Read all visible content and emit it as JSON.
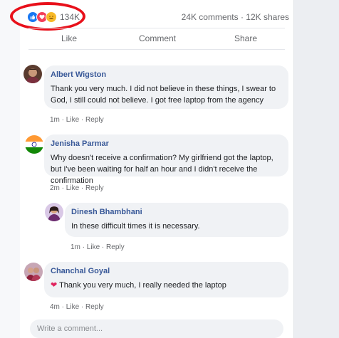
{
  "post": {
    "reaction_count": "134K",
    "stats": "24K comments · 12K shares",
    "reaction_icons": [
      "like-icon",
      "love-icon",
      "haha-icon"
    ],
    "highlight_color": "#e8101a"
  },
  "actions": {
    "like": "Like",
    "comment": "Comment",
    "share": "Share"
  },
  "comments": [
    {
      "name": "Albert Wigston",
      "text": "Thank you very much. I did not believe in these things, I swear to God, I still could not believe. I got free laptop from the agency",
      "time": "1m",
      "like": "Like",
      "reply": "Reply"
    },
    {
      "name": "Jenisha Parmar",
      "text": "Why doesn't receive a confirmation? My girlfriend got the laptop, but I've been waiting for half an hour and I didn't receive the confirmation",
      "time": "2m",
      "like": "Like",
      "reply": "Reply"
    },
    {
      "name": "Dinesh Bhambhani",
      "text": "In these difficult times it is necessary.",
      "time": "1m",
      "like": "Like",
      "reply": "Reply"
    },
    {
      "name": "Chanchal Goyal",
      "text": "Thank you very much, I really needed the laptop",
      "time": "4m",
      "like": "Like",
      "reply": "Reply"
    }
  ],
  "composer": {
    "placeholder": "Write a comment..."
  },
  "colors": {
    "name": "#385898",
    "bubble": "#f0f2f5",
    "muted": "#65676b"
  }
}
